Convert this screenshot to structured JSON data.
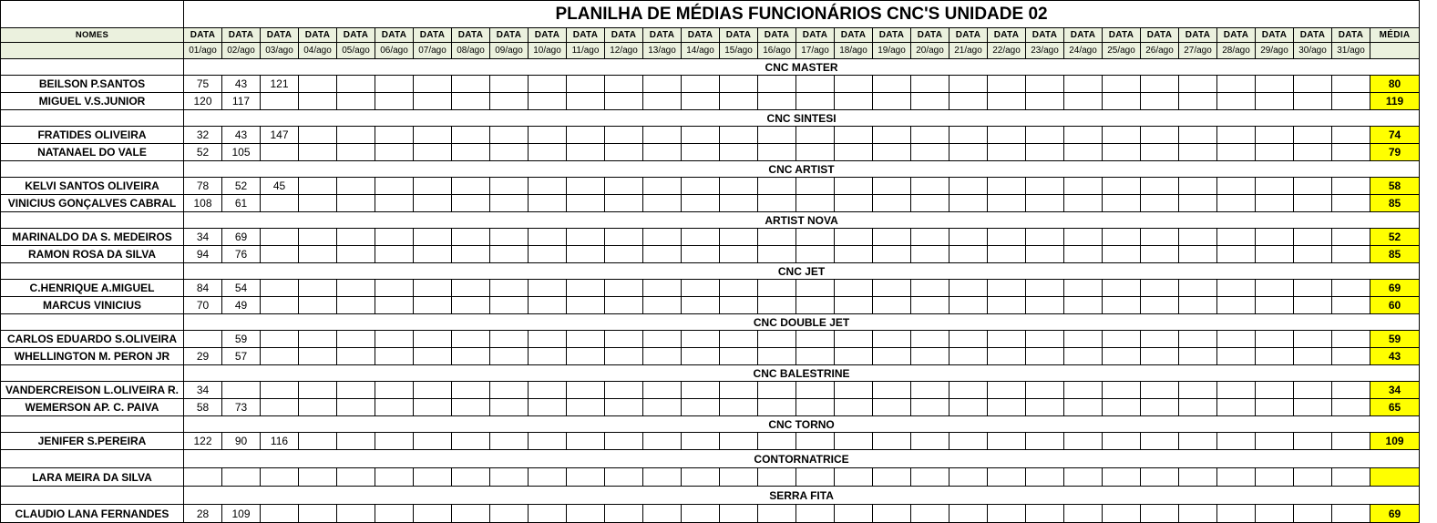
{
  "sheet": {
    "title": "PLANILHA DE MÉDIAS FUNCIONÁRIOS CNC'S UNIDADE 02",
    "names_header": "NOMES",
    "date_header": "DATA",
    "avg_header": "MÉDIA",
    "dates": [
      "01/ago",
      "02/ago",
      "03/ago",
      "04/ago",
      "05/ago",
      "06/ago",
      "07/ago",
      "08/ago",
      "09/ago",
      "10/ago",
      "11/ago",
      "12/ago",
      "13/ago",
      "14/ago",
      "15/ago",
      "16/ago",
      "17/ago",
      "18/ago",
      "19/ago",
      "20/ago",
      "21/ago",
      "22/ago",
      "23/ago",
      "24/ago",
      "25/ago",
      "26/ago",
      "27/ago",
      "28/ago",
      "29/ago",
      "30/ago",
      "31/ago"
    ],
    "groups": [
      {
        "name": "CNC MASTER",
        "people": [
          {
            "name": "BEILSON P.SANTOS",
            "values": [
              "75",
              "43",
              "121"
            ],
            "avg": "80"
          },
          {
            "name": "MIGUEL V.S.JUNIOR",
            "values": [
              "120",
              "117"
            ],
            "avg": "119"
          }
        ]
      },
      {
        "name": "CNC SINTESI",
        "people": [
          {
            "name": "FRATIDES OLIVEIRA",
            "values": [
              "32",
              "43",
              "147"
            ],
            "avg": "74"
          },
          {
            "name": "NATANAEL DO VALE",
            "values": [
              "52",
              "105"
            ],
            "avg": "79"
          }
        ]
      },
      {
        "name": "CNC ARTIST",
        "people": [
          {
            "name": "KELVI SANTOS OLIVEIRA",
            "values": [
              "78",
              "52",
              "45"
            ],
            "avg": "58"
          },
          {
            "name": "VINICIUS GONÇALVES CABRAL",
            "values": [
              "108",
              "61"
            ],
            "avg": "85"
          }
        ]
      },
      {
        "name": "ARTIST NOVA",
        "people": [
          {
            "name": "MARINALDO DA S. MEDEIROS",
            "values": [
              "34",
              "69"
            ],
            "avg": "52"
          },
          {
            "name": "RAMON ROSA DA SILVA",
            "values": [
              "94",
              "76"
            ],
            "avg": "85"
          }
        ]
      },
      {
        "name": "CNC JET",
        "people": [
          {
            "name": "C.HENRIQUE A.MIGUEL",
            "values": [
              "84",
              "54"
            ],
            "avg": "69"
          },
          {
            "name": "MARCUS VINICIUS",
            "values": [
              "70",
              "49"
            ],
            "avg": "60"
          }
        ]
      },
      {
        "name": "CNC DOUBLE JET",
        "people": [
          {
            "name": "CARLOS EDUARDO S.OLIVEIRA",
            "values": [
              "",
              "59"
            ],
            "avg": "59"
          },
          {
            "name": "WHELLINGTON M. PERON JR",
            "values": [
              "29",
              "57"
            ],
            "avg": "43"
          }
        ]
      },
      {
        "name": "CNC BALESTRINE",
        "people": [
          {
            "name": "VANDERCREISON L.OLIVEIRA R.",
            "values": [
              "34"
            ],
            "avg": "34"
          },
          {
            "name": "WEMERSON AP. C. PAIVA",
            "values": [
              "58",
              "73"
            ],
            "avg": "65"
          }
        ]
      },
      {
        "name": "CNC TORNO",
        "people": [
          {
            "name": "JENIFER S.PEREIRA",
            "values": [
              "122",
              "90",
              "116"
            ],
            "avg": "109"
          }
        ]
      },
      {
        "name": "CONTORNATRICE",
        "people": [
          {
            "name": "LARA MEIRA DA SILVA",
            "values": [],
            "avg": ""
          }
        ]
      },
      {
        "name": "SERRA FITA",
        "people": [
          {
            "name": "CLAUDIO LANA FERNANDES",
            "values": [
              "28",
              "109"
            ],
            "avg": "69"
          }
        ]
      }
    ]
  },
  "colors": {
    "header_bg": "#ebf1de",
    "average_bg": "#ffff00"
  }
}
